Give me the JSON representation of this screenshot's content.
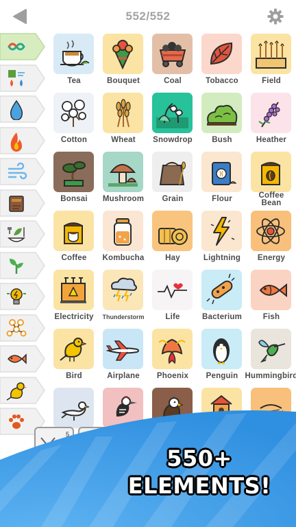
{
  "header": {
    "counter": "552/552"
  },
  "sidebar": {
    "tabs": [
      {
        "name": "infinity-icon",
        "color": "#29a98b"
      },
      {
        "name": "four-elements-icon",
        "color": "#3a8fd8"
      },
      {
        "name": "water-drop-icon",
        "color": "#4aa3df"
      },
      {
        "name": "fire-icon",
        "color": "#f0592a"
      },
      {
        "name": "wind-icon",
        "color": "#6fb6e8"
      },
      {
        "name": "earth-icon",
        "color": "#8b5a3c"
      },
      {
        "name": "food-icon",
        "color": "#5c9e3b"
      },
      {
        "name": "plant-icon",
        "color": "#4caf50"
      },
      {
        "name": "energy-icon",
        "color": "#f5b800"
      },
      {
        "name": "molecule-icon",
        "color": "#f0a030"
      },
      {
        "name": "fish-icon",
        "color": "#f07840"
      },
      {
        "name": "bird-icon",
        "color": "#f5c400"
      },
      {
        "name": "paw-icon",
        "color": "#e05a20"
      }
    ]
  },
  "elements": [
    {
      "label": "Tea",
      "icon": "tea-icon",
      "bg": "#d7eaf6"
    },
    {
      "label": "Bouquet",
      "icon": "bouquet-icon",
      "bg": "#fbe3a3"
    },
    {
      "label": "Coal",
      "icon": "coal-cart-icon",
      "bg": "#e4bfa8"
    },
    {
      "label": "Tobacco",
      "icon": "tobacco-leaf-icon",
      "bg": "#fbd7cc"
    },
    {
      "label": "Field",
      "icon": "field-icon",
      "bg": "#fbe3a3"
    },
    {
      "label": "Cotton",
      "icon": "cotton-icon",
      "bg": "#eef2f7"
    },
    {
      "label": "Wheat",
      "icon": "wheat-icon",
      "bg": "#fbe3a3"
    },
    {
      "label": "Snowdrop",
      "icon": "snowdrop-icon",
      "bg": "#27c29a"
    },
    {
      "label": "Bush",
      "icon": "bush-icon",
      "bg": "#d2ecc0"
    },
    {
      "label": "Heather",
      "icon": "heather-icon",
      "bg": "#fbe3e9"
    },
    {
      "label": "Bonsai",
      "icon": "bonsai-icon",
      "bg": "#8a6c5a"
    },
    {
      "label": "Mushroom",
      "icon": "mushroom-icon",
      "bg": "#a7d7c6"
    },
    {
      "label": "Grain",
      "icon": "grain-sack-icon",
      "bg": "#eeeeee"
    },
    {
      "label": "Flour",
      "icon": "flour-bag-icon",
      "bg": "#fbe6cf"
    },
    {
      "label": "Coffee Bean",
      "icon": "coffee-bag-icon",
      "bg": "#fbe3a3"
    },
    {
      "label": "Coffee",
      "icon": "coffee-icon",
      "bg": "#fbe3a3"
    },
    {
      "label": "Kombucha",
      "icon": "kombucha-jar-icon",
      "bg": "#fbe6d3"
    },
    {
      "label": "Hay",
      "icon": "hay-bale-icon",
      "bg": "#f8c47e"
    },
    {
      "label": "Lightning",
      "icon": "lightning-icon",
      "bg": "#fbe6cf"
    },
    {
      "label": "Energy",
      "icon": "energy-atom-icon",
      "bg": "#f8c07a"
    },
    {
      "label": "Electricity",
      "icon": "electricity-icon",
      "bg": "#fbe3a3"
    },
    {
      "label": "Thunderstorm",
      "icon": "thunderstorm-icon",
      "bg": "#fbe6b8",
      "small": true
    },
    {
      "label": "Life",
      "icon": "heartbeat-icon",
      "bg": "#f7f4f6"
    },
    {
      "label": "Bacterium",
      "icon": "bacterium-icon",
      "bg": "#c9ecf6"
    },
    {
      "label": "Fish",
      "icon": "fish-icon",
      "bg": "#fbd3c3"
    },
    {
      "label": "Bird",
      "icon": "canary-icon",
      "bg": "#fbe3a3"
    },
    {
      "label": "Airplane",
      "icon": "airplane-icon",
      "bg": "#c9e6f6"
    },
    {
      "label": "Phoenix",
      "icon": "phoenix-icon",
      "bg": "#fbe3a3"
    },
    {
      "label": "Penguin",
      "icon": "penguin-icon",
      "bg": "#c9ecf6"
    },
    {
      "label": "Hummingbird",
      "icon": "hummingbird-icon",
      "bg": "#e9e4dc"
    },
    {
      "label": "",
      "icon": "seagull-icon",
      "bg": "#dde6f0"
    },
    {
      "label": "",
      "icon": "woodpecker-icon",
      "bg": "#f2c0c0"
    },
    {
      "label": "",
      "icon": "eagle-icon",
      "bg": "#8a5e48"
    },
    {
      "label": "",
      "icon": "birdhouse-icon",
      "bg": "#fbe3a3"
    },
    {
      "label": "",
      "icon": "nest-icon",
      "bg": "#f8c07a"
    }
  ],
  "banner": {
    "line1": "550+",
    "line2": "ELEMENTS!",
    "color": "#2f8fe0"
  }
}
